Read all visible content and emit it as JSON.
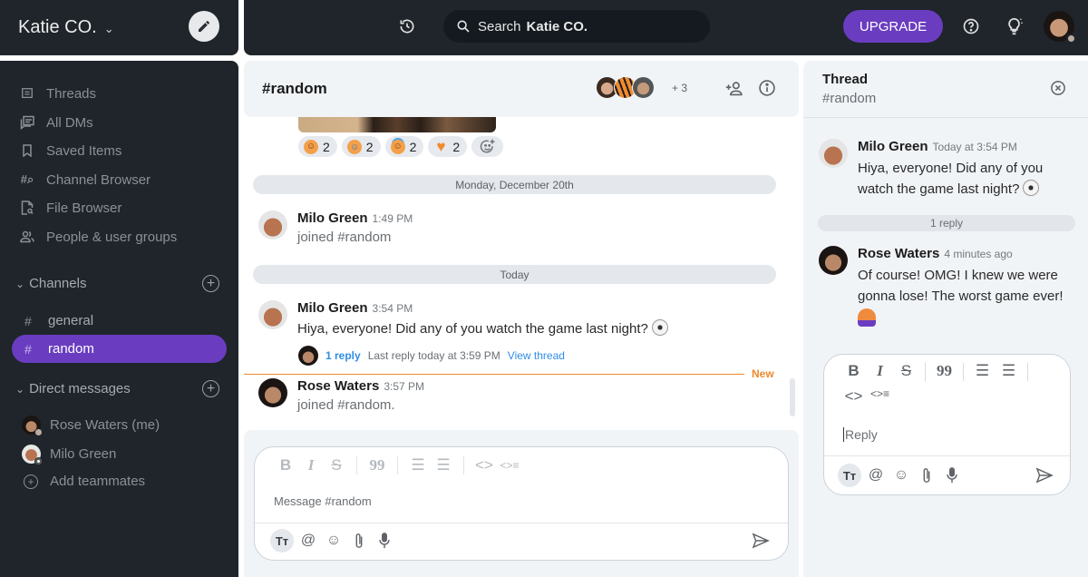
{
  "workspace": {
    "name": "Katie CO.",
    "compose_icon": "pencil-icon"
  },
  "topbar": {
    "history_icon": "history-icon",
    "search_label": "Search",
    "search_workspace": "Katie CO.",
    "upgrade_label": "UPGRADE",
    "help_icon": "help-icon",
    "tips_icon": "lightbulb-icon",
    "accent": "#6a3dc0"
  },
  "sidebar": {
    "nav": [
      {
        "label": "Threads",
        "icon": "threads-icon"
      },
      {
        "label": "All DMs",
        "icon": "all-dms-icon"
      },
      {
        "label": "Saved Items",
        "icon": "bookmark-icon"
      },
      {
        "label": "Channel Browser",
        "icon": "channel-search-icon"
      },
      {
        "label": "File Browser",
        "icon": "file-search-icon"
      },
      {
        "label": "People & user groups",
        "icon": "people-icon"
      }
    ],
    "channels_label": "Channels",
    "channels": [
      {
        "name": "general",
        "active": false
      },
      {
        "name": "random",
        "active": true
      }
    ],
    "dms_label": "Direct messages",
    "dms": [
      {
        "name": "Rose Waters (me)"
      },
      {
        "name": "Milo Green"
      }
    ],
    "add_teammates": "Add teammates"
  },
  "channel": {
    "title": "#random",
    "extra_members": "+ 3",
    "reactions": [
      {
        "emoji": "grinning-face",
        "count": "2"
      },
      {
        "emoji": "rolling-laughing-face",
        "count": "2"
      },
      {
        "emoji": "halo-face",
        "count": "2"
      },
      {
        "emoji": "orange-heart",
        "count": "2"
      }
    ],
    "dividers": [
      "Monday, December 20th",
      "Today"
    ],
    "messages": [
      {
        "author": "Milo Green",
        "time": "1:49 PM",
        "text": "joined #random",
        "system": true
      },
      {
        "author": "Milo Green",
        "time": "3:54 PM",
        "text": "Hiya, everyone! Did any of you watch the game last night?",
        "emoji": "soccer-ball"
      },
      {
        "author": "Rose Waters",
        "time": "3:57 PM",
        "text": "joined #random.",
        "system": true
      }
    ],
    "thread_summary": {
      "count": "1 reply",
      "last": "Last reply today at 3:59 PM",
      "view": "View thread"
    },
    "new_label": "New",
    "composer_placeholder": "Message #random"
  },
  "thread": {
    "title": "Thread",
    "channel": "#random",
    "parent": {
      "author": "Milo Green",
      "time": "Today at 3:54 PM",
      "text": "Hiya, everyone! Did any of you watch the game last night?"
    },
    "reply_count": "1 reply",
    "replies": [
      {
        "author": "Rose Waters",
        "time": "4 minutes ago",
        "text": "Of course! OMG! I knew we were gonna lose! The worst game ever!"
      }
    ],
    "composer_placeholder": "Reply"
  }
}
